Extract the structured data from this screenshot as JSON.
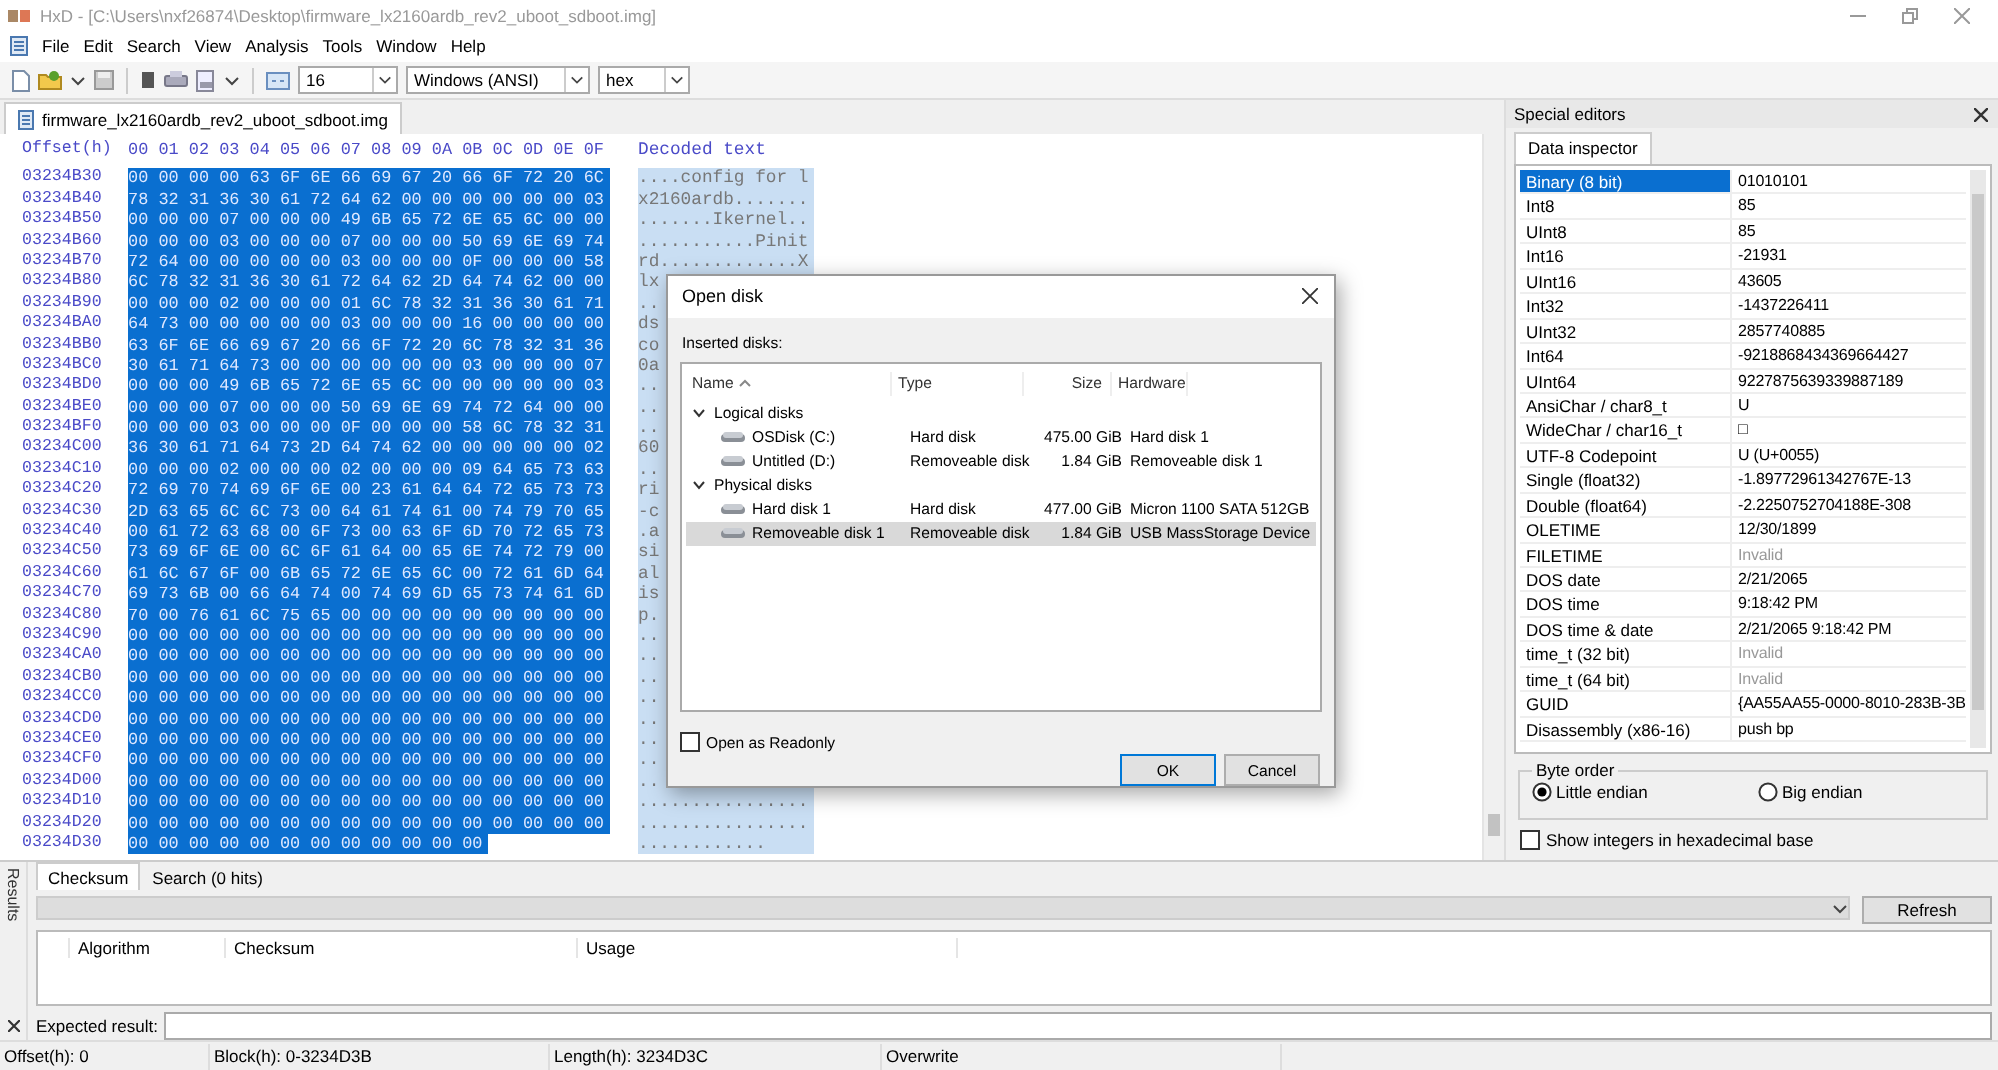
{
  "window": {
    "title": "HxD - [C:\\Users\\nxf26874\\Desktop\\firmware_lx2160ardb_rev2_uboot_sdboot.img]"
  },
  "menu": [
    "File",
    "Edit",
    "Search",
    "View",
    "Analysis",
    "Tools",
    "Window",
    "Help"
  ],
  "toolbar": {
    "bytes_per_row": "16",
    "charset": "Windows (ANSI)",
    "offset_base": "hex"
  },
  "document_tabs": [
    {
      "label": "firmware_lx2160ardb_rev2_uboot_sdboot.img",
      "selected": true
    }
  ],
  "hex_view": {
    "offset_header": "Offset(h)",
    "column_headers": [
      "00",
      "01",
      "02",
      "03",
      "04",
      "05",
      "06",
      "07",
      "08",
      "09",
      "0A",
      "0B",
      "0C",
      "0D",
      "0E",
      "0F"
    ],
    "decoded_header": "Decoded text",
    "rows": [
      {
        "offset": "03234B30",
        "bytes": "00 00 00 00 63 6F 6E 66 69 67 20 66 6F 72 20 6C",
        "decoded": "....config for l",
        "selected": true
      },
      {
        "offset": "03234B40",
        "bytes": "78 32 31 36 30 61 72 64 62 00 00 00 00 00 00 03",
        "decoded": "x2160ardb.......",
        "selected": true
      },
      {
        "offset": "03234B50",
        "bytes": "00 00 00 07 00 00 00 49 6B 65 72 6E 65 6C 00 00",
        "decoded": ".......Ikernel..",
        "selected": true
      },
      {
        "offset": "03234B60",
        "bytes": "00 00 00 03 00 00 00 07 00 00 00 50 69 6E 69 74",
        "decoded": "...........Pinit",
        "selected": true
      },
      {
        "offset": "03234B70",
        "bytes": "72 64 00 00 00 00 00 03 00 00 00 0F 00 00 00 58",
        "decoded": "rd.............X",
        "selected": true
      },
      {
        "offset": "03234B80",
        "bytes": "6C 78 32 31 36 30 61 72 64 62 2D 64 74 62 00 00",
        "decoded": "lx",
        "selected": true
      },
      {
        "offset": "03234B90",
        "bytes": "00 00 00 02 00 00 00 01 6C 78 32 31 36 30 61 71",
        "decoded": "..",
        "selected": true
      },
      {
        "offset": "03234BA0",
        "bytes": "64 73 00 00 00 00 00 03 00 00 00 16 00 00 00 00",
        "decoded": "ds",
        "selected": true
      },
      {
        "offset": "03234BB0",
        "bytes": "63 6F 6E 66 69 67 20 66 6F 72 20 6C 78 32 31 36",
        "decoded": "co",
        "selected": true
      },
      {
        "offset": "03234BC0",
        "bytes": "30 61 71 64 73 00 00 00 00 00 00 03 00 00 00 07",
        "decoded": "0a",
        "selected": true
      },
      {
        "offset": "03234BD0",
        "bytes": "00 00 00 49 6B 65 72 6E 65 6C 00 00 00 00 00 03",
        "decoded": "..",
        "selected": true
      },
      {
        "offset": "03234BE0",
        "bytes": "00 00 00 07 00 00 00 50 69 6E 69 74 72 64 00 00",
        "decoded": "..",
        "selected": true
      },
      {
        "offset": "03234BF0",
        "bytes": "00 00 00 03 00 00 00 0F 00 00 00 58 6C 78 32 31",
        "decoded": "..",
        "selected": true
      },
      {
        "offset": "03234C00",
        "bytes": "36 30 61 71 64 73 2D 64 74 62 00 00 00 00 00 02",
        "decoded": "60",
        "selected": true
      },
      {
        "offset": "03234C10",
        "bytes": "00 00 00 02 00 00 00 02 00 00 00 09 64 65 73 63",
        "decoded": "..",
        "selected": true
      },
      {
        "offset": "03234C20",
        "bytes": "72 69 70 74 69 6F 6E 00 23 61 64 64 72 65 73 73",
        "decoded": "ri",
        "selected": true
      },
      {
        "offset": "03234C30",
        "bytes": "2D 63 65 6C 6C 73 00 64 61 74 61 00 74 79 70 65",
        "decoded": "-c",
        "selected": true
      },
      {
        "offset": "03234C40",
        "bytes": "00 61 72 63 68 00 6F 73 00 63 6F 6D 70 72 65 73",
        "decoded": ".a",
        "selected": true
      },
      {
        "offset": "03234C50",
        "bytes": "73 69 6F 6E 00 6C 6F 61 64 00 65 6E 74 72 79 00",
        "decoded": "si",
        "selected": true
      },
      {
        "offset": "03234C60",
        "bytes": "61 6C 67 6F 00 6B 65 72 6E 65 6C 00 72 61 6D 64",
        "decoded": "al",
        "selected": true
      },
      {
        "offset": "03234C70",
        "bytes": "69 73 6B 00 66 64 74 00 74 69 6D 65 73 74 61 6D",
        "decoded": "is",
        "selected": true
      },
      {
        "offset": "03234C80",
        "bytes": "70 00 76 61 6C 75 65 00 00 00 00 00 00 00 00 00",
        "decoded": "p.",
        "selected": true
      },
      {
        "offset": "03234C90",
        "bytes": "00 00 00 00 00 00 00 00 00 00 00 00 00 00 00 00",
        "decoded": "..",
        "selected": true
      },
      {
        "offset": "03234CA0",
        "bytes": "00 00 00 00 00 00 00 00 00 00 00 00 00 00 00 00",
        "decoded": "..",
        "selected": true
      },
      {
        "offset": "03234CB0",
        "bytes": "00 00 00 00 00 00 00 00 00 00 00 00 00 00 00 00",
        "decoded": "..",
        "selected": true
      },
      {
        "offset": "03234CC0",
        "bytes": "00 00 00 00 00 00 00 00 00 00 00 00 00 00 00 00",
        "decoded": "..",
        "selected": true
      },
      {
        "offset": "03234CD0",
        "bytes": "00 00 00 00 00 00 00 00 00 00 00 00 00 00 00 00",
        "decoded": "..",
        "selected": true
      },
      {
        "offset": "03234CE0",
        "bytes": "00 00 00 00 00 00 00 00 00 00 00 00 00 00 00 00",
        "decoded": "..",
        "selected": true
      },
      {
        "offset": "03234CF0",
        "bytes": "00 00 00 00 00 00 00 00 00 00 00 00 00 00 00 00",
        "decoded": "..",
        "selected": true
      },
      {
        "offset": "03234D00",
        "bytes": "00 00 00 00 00 00 00 00 00 00 00 00 00 00 00 00",
        "decoded": "..",
        "selected": true
      },
      {
        "offset": "03234D10",
        "bytes": "00 00 00 00 00 00 00 00 00 00 00 00 00 00 00 00",
        "decoded": "................",
        "selected": true
      },
      {
        "offset": "03234D20",
        "bytes": "00 00 00 00 00 00 00 00 00 00 00 00 00 00 00 00",
        "decoded": "................",
        "selected": true
      },
      {
        "offset": "03234D30",
        "bytes": "00 00 00 00 00 00 00 00 00 00 00 00",
        "decoded": "............",
        "selected": true
      }
    ]
  },
  "open_disk_dialog": {
    "title": "Open disk",
    "list_label": "Inserted disks:",
    "columns": [
      {
        "label": "Name",
        "sorted": true
      },
      {
        "label": "Type",
        "sorted": false
      },
      {
        "label": "Size",
        "sorted": false
      },
      {
        "label": "Hardware",
        "sorted": false
      }
    ],
    "groups": [
      {
        "name": "Logical disks",
        "expanded": true,
        "selected": false,
        "children": [
          {
            "name": "OSDisk (C:)",
            "type": "Hard disk",
            "size": "475.00 GiB",
            "hardware": "Hard disk 1",
            "selected": false
          },
          {
            "name": "Untitled (D:)",
            "type": "Removeable disk",
            "size": "1.84 GiB",
            "hardware": "Removeable disk 1",
            "selected": false
          }
        ]
      },
      {
        "name": "Physical disks",
        "expanded": true,
        "selected": false,
        "children": [
          {
            "name": "Hard disk 1",
            "type": "Hard disk",
            "size": "477.00 GiB",
            "hardware": "Micron 1100 SATA 512GB",
            "selected": false
          },
          {
            "name": "Removeable disk 1",
            "type": "Removeable disk",
            "size": "1.84 GiB",
            "hardware": "USB MassStorage Device",
            "selected": true
          }
        ]
      }
    ],
    "readonly": {
      "label": "Open as Readonly",
      "checked": false
    },
    "buttons": [
      "OK",
      "Cancel"
    ]
  },
  "special_editors": {
    "title": "Special editors",
    "tabs": [
      {
        "label": "Data inspector",
        "selected": true
      }
    ],
    "rows": [
      {
        "name": "Binary (8 bit)",
        "value": "01010101",
        "selected": true,
        "disabled": false
      },
      {
        "name": "Int8",
        "value": "85",
        "selected": false,
        "disabled": false
      },
      {
        "name": "UInt8",
        "value": "85",
        "selected": false,
        "disabled": false
      },
      {
        "name": "Int16",
        "value": "-21931",
        "selected": false,
        "disabled": false
      },
      {
        "name": "UInt16",
        "value": "43605",
        "selected": false,
        "disabled": false
      },
      {
        "name": "Int32",
        "value": "-1437226411",
        "selected": false,
        "disabled": false
      },
      {
        "name": "UInt32",
        "value": "2857740885",
        "selected": false,
        "disabled": false
      },
      {
        "name": "Int64",
        "value": "-9218868434369664427",
        "selected": false,
        "disabled": false
      },
      {
        "name": "UInt64",
        "value": "9227875639339887189",
        "selected": false,
        "disabled": false
      },
      {
        "name": "AnsiChar / char8_t",
        "value": "U",
        "selected": false,
        "disabled": false
      },
      {
        "name": "WideChar / char16_t",
        "value": "□",
        "selected": false,
        "disabled": false
      },
      {
        "name": "UTF-8 Codepoint",
        "value": "U (U+0055)",
        "selected": false,
        "disabled": false
      },
      {
        "name": "Single (float32)",
        "value": "-1.89772961342767E-13",
        "selected": false,
        "disabled": false
      },
      {
        "name": "Double (float64)",
        "value": "-2.2250752704188E-308",
        "selected": false,
        "disabled": false
      },
      {
        "name": "OLETIME",
        "value": "12/30/1899",
        "selected": false,
        "disabled": false
      },
      {
        "name": "FILETIME",
        "value": "Invalid",
        "selected": false,
        "disabled": true
      },
      {
        "name": "DOS date",
        "value": "2/21/2065",
        "selected": false,
        "disabled": false
      },
      {
        "name": "DOS time",
        "value": "9:18:42 PM",
        "selected": false,
        "disabled": false
      },
      {
        "name": "DOS time & date",
        "value": "2/21/2065 9:18:42 PM",
        "selected": false,
        "disabled": false
      },
      {
        "name": "time_t (32 bit)",
        "value": "Invalid",
        "selected": false,
        "disabled": true
      },
      {
        "name": "time_t (64 bit)",
        "value": "Invalid",
        "selected": false,
        "disabled": true
      },
      {
        "name": "GUID",
        "value": "{AA55AA55-0000-8010-283B-3B",
        "selected": false,
        "disabled": false
      },
      {
        "name": "Disassembly (x86-16)",
        "value": "push bp",
        "selected": false,
        "disabled": false
      }
    ],
    "byte_order": {
      "label": "Byte order",
      "options": [
        {
          "label": "Little endian",
          "selected": true
        },
        {
          "label": "Big endian",
          "selected": false
        }
      ]
    },
    "hex_integers": {
      "label": "Show integers in hexadecimal base",
      "checked": false
    }
  },
  "results_panel": {
    "title": "Results",
    "tabs": [
      {
        "label": "Checksum",
        "selected": true
      },
      {
        "label": "Search (0 hits)",
        "selected": false
      }
    ],
    "refresh_button": "Refresh",
    "columns": [
      "Algorithm",
      "Checksum",
      "Usage"
    ],
    "expected_result_label": "Expected result:"
  },
  "status_bar": [
    "Offset(h): 0",
    "Block(h): 0-3234D3B",
    "Length(h): 3234D3C",
    "Overwrite"
  ]
}
